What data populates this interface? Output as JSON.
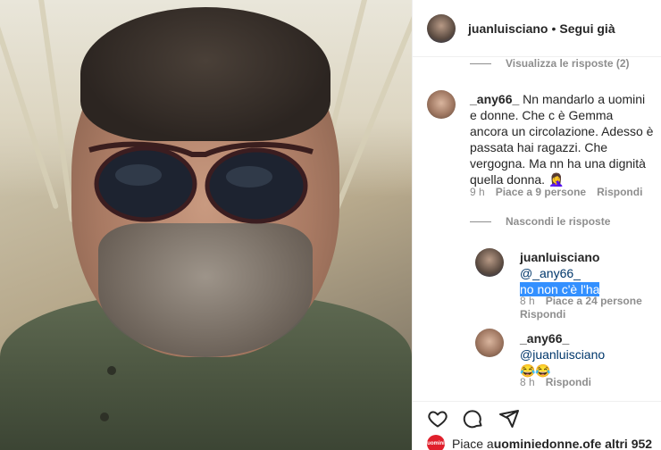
{
  "post": {
    "username": "juanluisciano",
    "separator": "•",
    "follow_label": "Segui già"
  },
  "comments": {
    "view_replies_top": "Visualizza le risposte (2)",
    "c1": {
      "username": "_any66_",
      "text": "Nn mandarlo a uomini e donne. Che c è Gemma ancora un circolazione. Adesso è passata hai ragazzi. Che vergogna. Ma nn ha una dignità quella donna. 🤦‍♀️",
      "time": "9 h",
      "likes": "Piace a 9 persone",
      "reply": "Rispondi"
    },
    "hide_replies": "Nascondi le risposte",
    "r1": {
      "username": "juanluisciano",
      "mention": "@_any66_",
      "text": "no non c'è l'ha",
      "time": "8 h",
      "likes": "Piace a 24 persone",
      "reply": "Rispondi"
    },
    "r2": {
      "username": "_any66_",
      "mention": "@juanluisciano",
      "text": "😂😂",
      "time": "8 h",
      "reply": "Rispondi"
    }
  },
  "footer": {
    "likes_prefix": "Piace a ",
    "likes_user": "uominiedonne.of",
    "likes_suffix": " e altri 952",
    "mini_avatar_text": "uomini",
    "icons": [
      "heart-icon",
      "comment-icon",
      "share-icon"
    ]
  }
}
